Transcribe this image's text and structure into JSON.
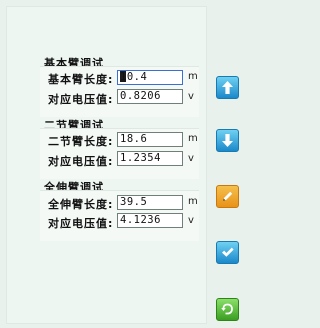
{
  "groups": [
    {
      "title": "基本臂调试",
      "length_label": "基本臂长度:",
      "length_value": "10.4",
      "length_unit": "m",
      "voltage_label": "对应电压值:",
      "voltage_value": "0.8206",
      "voltage_unit": "v"
    },
    {
      "title": "二节臂调试",
      "length_label": "二节臂长度:",
      "length_value": "18.6",
      "length_unit": "m",
      "voltage_label": "对应电压值:",
      "voltage_value": "1.2354",
      "voltage_unit": "v"
    },
    {
      "title": "全伸臂调试",
      "length_label": "全伸臂长度:",
      "length_value": "39.5",
      "length_unit": "m",
      "voltage_label": "对应电压值:",
      "voltage_value": "4.1236",
      "voltage_unit": "v"
    }
  ],
  "buttons": [
    {
      "icon": "arrow-up-icon",
      "color": "#1b88c9"
    },
    {
      "icon": "arrow-down-icon",
      "color": "#1b88c9"
    },
    {
      "icon": "pencil-icon",
      "color": "#e89219"
    },
    {
      "icon": "checkmark-icon",
      "color": "#1b88c9"
    },
    {
      "icon": "return-icon",
      "color": "#3a9e21"
    }
  ]
}
